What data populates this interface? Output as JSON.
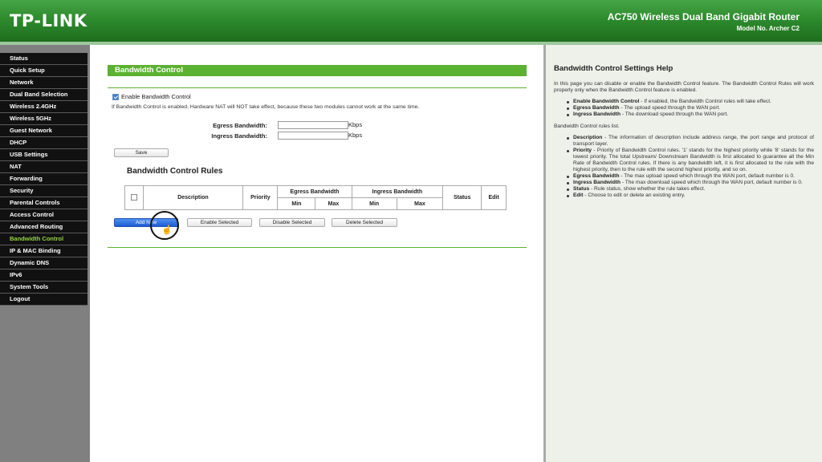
{
  "header": {
    "logo": "TP-LINK",
    "model_title": "AC750 Wireless Dual Band Gigabit Router",
    "model_no": "Model No. Archer C2"
  },
  "sidebar": {
    "items": [
      {
        "label": "Status"
      },
      {
        "label": "Quick Setup"
      },
      {
        "label": "Network"
      },
      {
        "label": "Dual Band Selection"
      },
      {
        "label": "Wireless 2.4GHz"
      },
      {
        "label": "Wireless 5GHz"
      },
      {
        "label": "Guest Network"
      },
      {
        "label": "DHCP"
      },
      {
        "label": "USB Settings"
      },
      {
        "label": "NAT"
      },
      {
        "label": "Forwarding"
      },
      {
        "label": "Security"
      },
      {
        "label": "Parental Controls"
      },
      {
        "label": "Access Control"
      },
      {
        "label": "Advanced Routing"
      },
      {
        "label": "Bandwidth Control",
        "active": true
      },
      {
        "label": "IP & MAC Binding"
      },
      {
        "label": "Dynamic DNS"
      },
      {
        "label": "IPv6"
      },
      {
        "label": "System Tools"
      },
      {
        "label": "Logout"
      }
    ],
    "active_color": "#93d243"
  },
  "main": {
    "title": "Bandwidth Control",
    "enable_label": "Enable Bandwidth Control",
    "enable_checked": true,
    "nat_note": "If Bandwidth Control is enabled, Hardware NAT will NOT take effect, because these two modules cannot work at the same time.",
    "egress_label": "Egress Bandwidth:",
    "egress_value": "",
    "ingress_label": "Ingress Bandwidth:",
    "ingress_value": "",
    "unit": "Kbps",
    "save_label": "Save",
    "rules_title": "Bandwidth Control Rules",
    "table": {
      "description": "Description",
      "priority": "Priority",
      "egress": "Egress Bandwidth",
      "ingress": "Ingress Bandwidth",
      "min": "Min",
      "max": "Max",
      "status": "Status",
      "edit": "Edit"
    },
    "add_new_label": "Add New",
    "enable_selected_label": "Enable Selected",
    "disable_selected_label": "Disable Selected",
    "delete_selected_label": "Delete Selected"
  },
  "help": {
    "title": "Bandwidth Control Settings Help",
    "intro": "In this page you can disable or enable the Bandwidth Control feature. The Bandwidth Control Rules will work properly only when the Bandwidth Control feature is enabled.",
    "list1": [
      {
        "term": "Enable Bandwidth Control",
        "desc": " - If enabled, the Bandwidth Control rules will take effect."
      },
      {
        "term": "Egress Bandwidth",
        "desc": " - The upload speed through the WAN port."
      },
      {
        "term": "Ingress Bandwidth",
        "desc": " - The download speed through the WAN port."
      }
    ],
    "rules_intro": "Bandwidth Control rules list.",
    "list2": [
      {
        "term": "Description",
        "desc": " - The information of description include address range, the port range and protocol of transport layer."
      },
      {
        "term": "Priority",
        "desc": " - Priority of Bandwidth Control rules. '1' stands for the highest priority while '8' stands for the lowest priority. The total Upstream/ Downstream Bandwidth is first allocated to guarantee all the Min Rate of Bandwidth Control rules. If there is any bandwidth left, it is first allocated to the rule with the highest priority, then to the rule with the second highest priority, and so on."
      },
      {
        "term": "Egress Bandwidth",
        "desc": " - The max upload speed which through the WAN port, default number is 0."
      },
      {
        "term": "Ingress Bandwidth",
        "desc": " - The max download speed which through the WAN port, default number is 0."
      },
      {
        "term": "Status",
        "desc": " - Rule status, show whether the rule takes effect."
      },
      {
        "term": "Edit",
        "desc": " - Choose to edit or delete an existing entry."
      }
    ]
  }
}
